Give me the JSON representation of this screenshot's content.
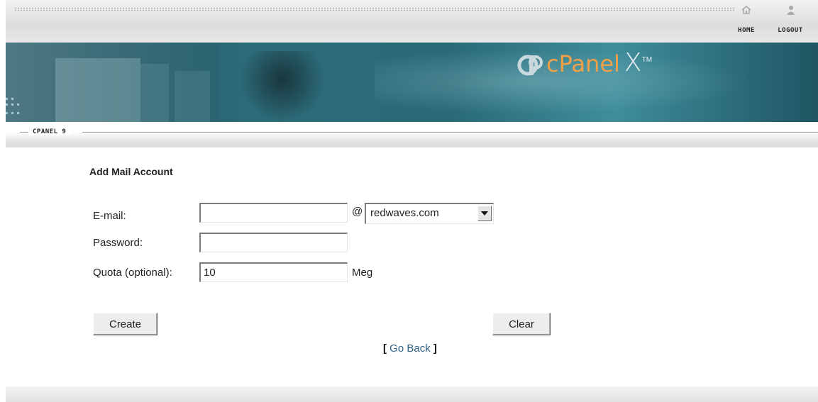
{
  "header": {
    "nav": [
      {
        "label": "HOME",
        "icon": "home-icon"
      },
      {
        "label": "LOGOUT",
        "icon": "user-icon"
      }
    ],
    "logo": {
      "text": "cPanel",
      "mark": "X",
      "tm": "TM"
    }
  },
  "breadcrumb": {
    "label": "CPANEL 9"
  },
  "form": {
    "title": "Add Mail Account",
    "email_label": "E-mail:",
    "email_value": "",
    "at_symbol": "@",
    "domain_selected": "redwaves.com",
    "password_label": "Password:",
    "password_value": "",
    "quota_label": "Quota (optional):",
    "quota_value": "10",
    "quota_unit": "Meg",
    "create_label": "Create",
    "clear_label": "Clear",
    "goback_open": "[",
    "goback_label": "Go Back",
    "goback_close": "]"
  },
  "colors": {
    "banner": "#2c6b78",
    "logo_orange": "#f0a046",
    "link": "#2e5f82"
  }
}
